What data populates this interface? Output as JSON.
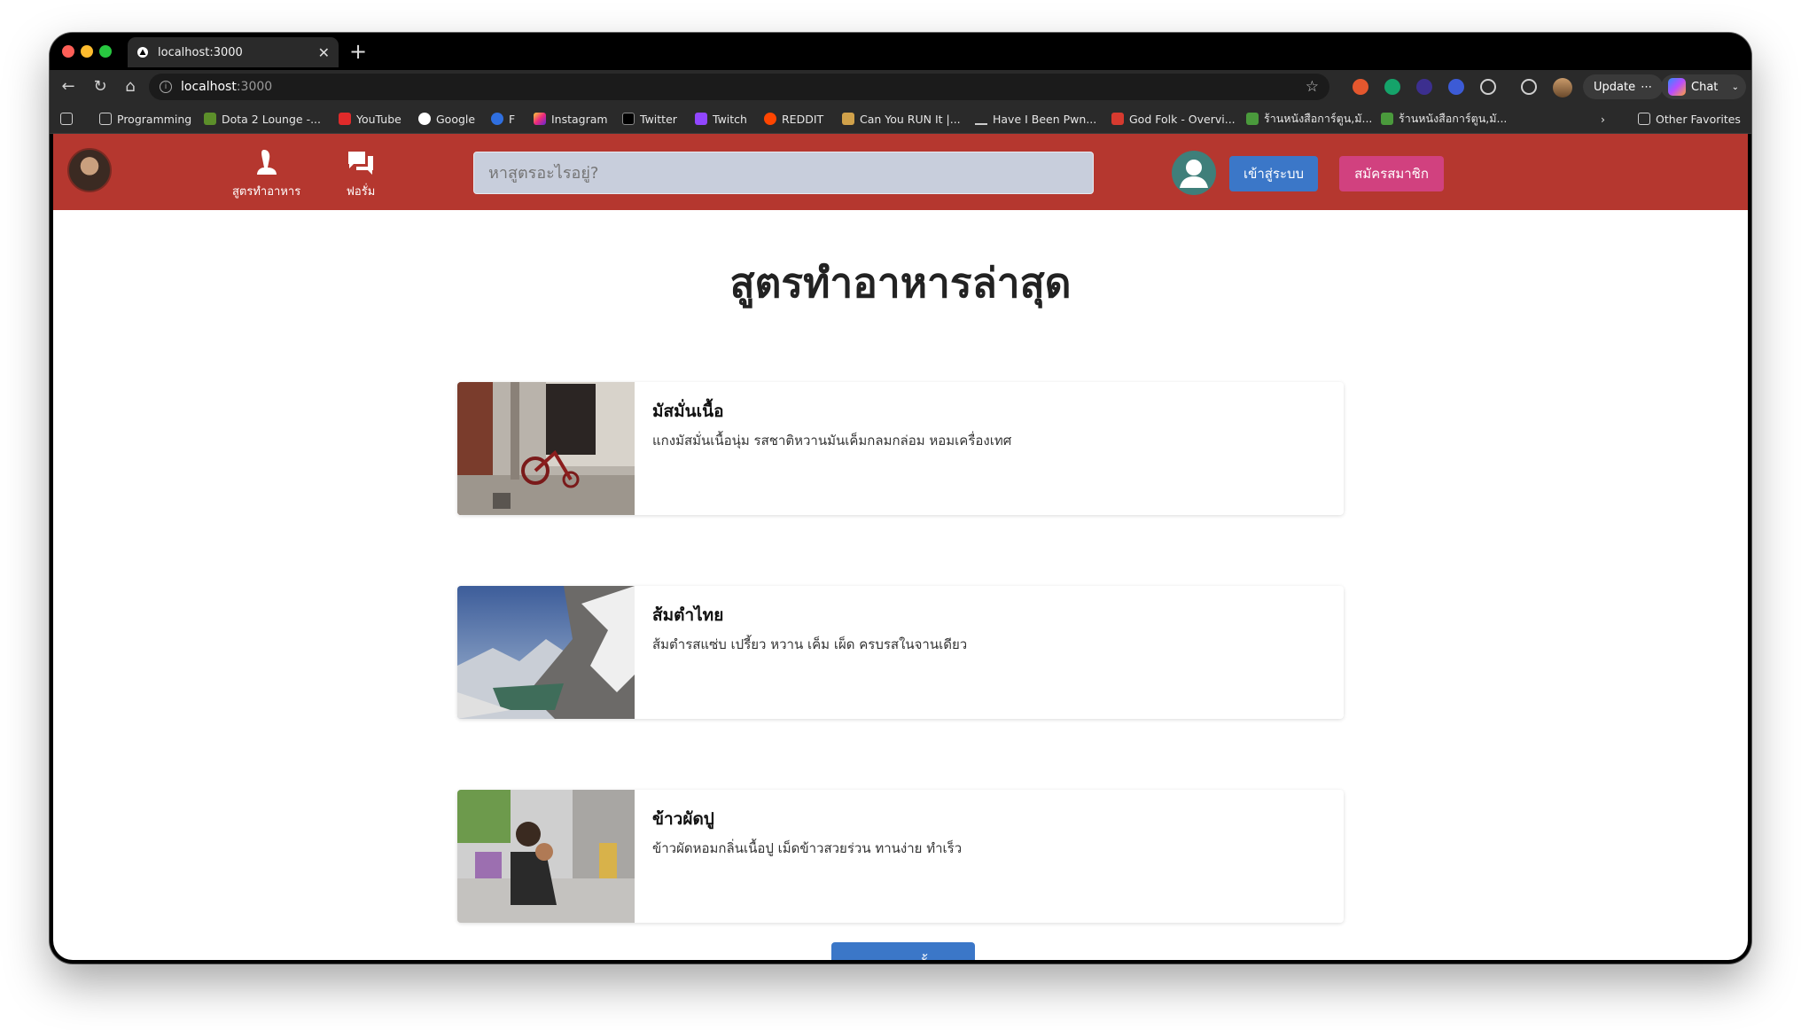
{
  "browser": {
    "tab": {
      "title": "localhost:3000"
    },
    "address": {
      "host": "localhost",
      "port": ":3000"
    },
    "update_label": "Update",
    "chat_label": "Chat",
    "bookmarks": [
      {
        "label": "Programming",
        "icon": "folder-icon"
      },
      {
        "label": "Dota 2 Lounge -...",
        "icon": "dota-icon"
      },
      {
        "label": "YouTube",
        "icon": "youtube-icon"
      },
      {
        "label": "Google",
        "icon": "google-icon"
      },
      {
        "label": "F",
        "icon": "facebook-icon"
      },
      {
        "label": "Instagram",
        "icon": "instagram-icon"
      },
      {
        "label": "Twitter",
        "icon": "x-icon"
      },
      {
        "label": "Twitch",
        "icon": "twitch-icon"
      },
      {
        "label": "REDDIT",
        "icon": "reddit-icon"
      },
      {
        "label": "Can You RUN It |...",
        "icon": "canyourunit-icon"
      },
      {
        "label": "Have I Been Pwn...",
        "icon": "hibp-icon"
      },
      {
        "label": "God Folk - Overvi...",
        "icon": "godfolk-icon"
      },
      {
        "label": "ร้านหนังสือการ์ตูน,มั...",
        "icon": "bookstore-icon"
      },
      {
        "label": "ร้านหนังสือการ์ตูน,มั...",
        "icon": "bookstore-icon"
      }
    ],
    "other_favorites": "Other Favorites"
  },
  "colors": {
    "nav_bg": "#b5372f",
    "login_btn": "#3b77c8",
    "signup_btn": "#d1417f",
    "search_bg": "#c8cedc"
  },
  "app": {
    "nav": {
      "recipes_label": "สูตรทำอาหาร",
      "forum_label": "ฟอรั่ม",
      "search_placeholder": "หาสูตรอะไรอยู่?",
      "login_label": "เข้าสู่ระบบ",
      "signup_label": "สมัครสมาชิก"
    },
    "page_title": "สูตรทำอาหารล่าสุด",
    "recipes": [
      {
        "title": "มัสมั่นเนื้อ",
        "desc": "แกงมัสมั่นเนื้อนุ่ม รสชาติหวานมันเค็มกลมกล่อม หอมเครื่องเทศ"
      },
      {
        "title": "ส้มตำไทย",
        "desc": "ส้มตำรสแซ่บ เปรี้ยว หวาน เค็ม เผ็ด ครบรสในจานเดียว"
      },
      {
        "title": "ข้าวผัดปู",
        "desc": "ข้าวผัดหอมกลิ่นเนื้อปู เม็ดข้าวสวยร่วน ทานง่าย ทำเร็ว"
      }
    ],
    "all_recipes_label": "ดูสูตรอาหารทั้งหมด"
  }
}
